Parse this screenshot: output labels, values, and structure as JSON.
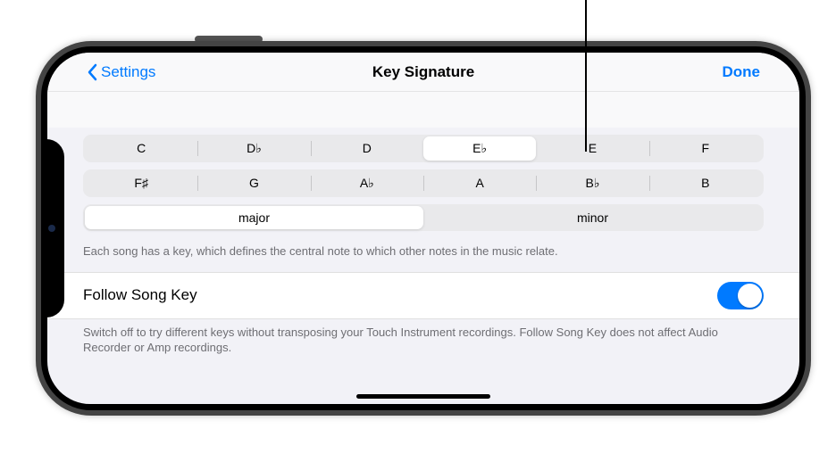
{
  "nav": {
    "back_label": "Settings",
    "title": "Key Signature",
    "done_label": "Done"
  },
  "keys_row1": [
    "C",
    "D♭",
    "D",
    "E♭",
    "E",
    "F"
  ],
  "keys_row2": [
    "F♯",
    "G",
    "A♭",
    "A",
    "B♭",
    "B"
  ],
  "selected_key": "E♭",
  "scale": {
    "major": "major",
    "minor": "minor",
    "selected": "major"
  },
  "footer1": "Each song has a key, which defines the central note to which other notes in the music relate.",
  "follow": {
    "label": "Follow Song Key",
    "on": true
  },
  "footer2": "Switch off to try different keys without transposing your Touch Instrument recordings. Follow Song Key does not affect Audio Recorder or Amp recordings."
}
